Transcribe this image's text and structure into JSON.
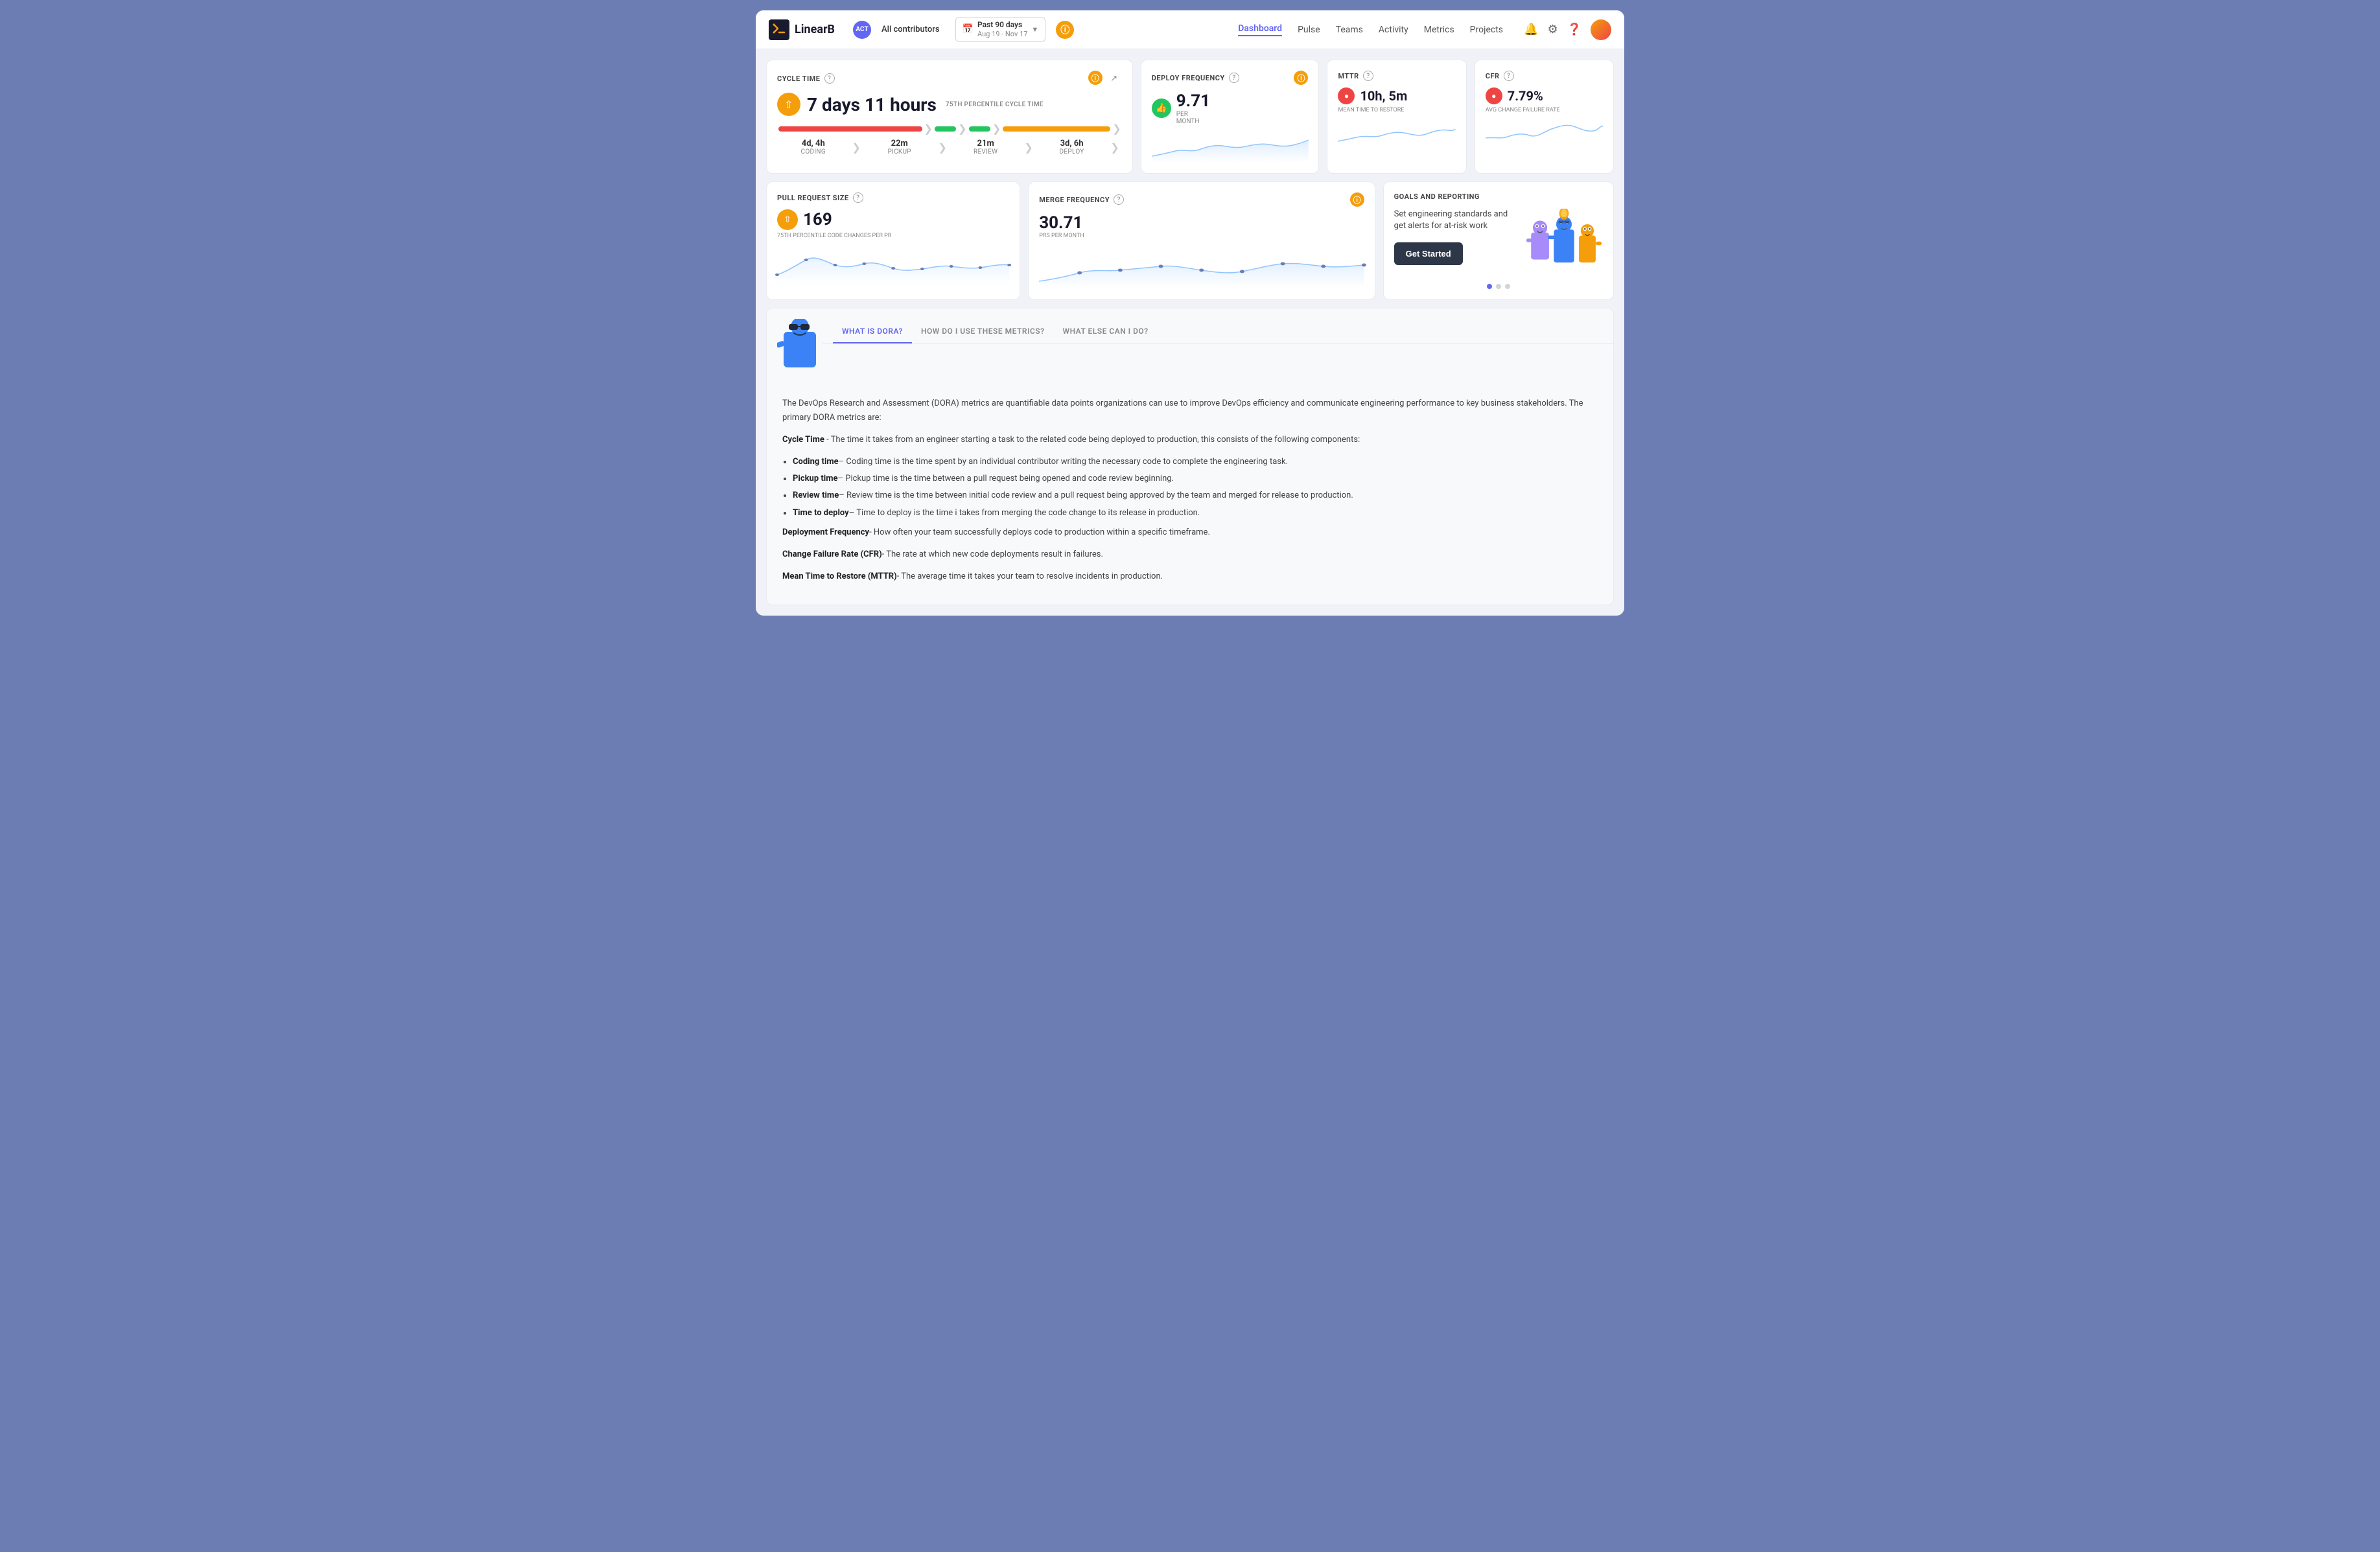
{
  "app": {
    "title": "LinearB",
    "logo_text": "LinearB"
  },
  "header": {
    "contributor_badge": "ACT",
    "contributor_label": "All contributors",
    "date_range_label": "Past 90 days",
    "date_range_sub": "Aug 19 - Nov 17",
    "nav": [
      {
        "label": "Dashboard",
        "active": true
      },
      {
        "label": "Pulse",
        "active": false
      },
      {
        "label": "Teams",
        "active": false
      },
      {
        "label": "Activity",
        "active": false
      },
      {
        "label": "Metrics",
        "active": false
      },
      {
        "label": "Projects",
        "active": false
      }
    ]
  },
  "cycle_time": {
    "title": "CYCLE TIME",
    "value": "7 days 11 hours",
    "subtitle": "75TH PERCENTILE CYCLE TIME",
    "stages": [
      {
        "value": "4d, 4h",
        "label": "CODING",
        "color": "#ef4444"
      },
      {
        "value": "22m",
        "label": "PICKUP",
        "color": "#22c55e"
      },
      {
        "value": "21m",
        "label": "REVIEW",
        "color": "#22c55e"
      },
      {
        "value": "3d, 6h",
        "label": "DEPLOY",
        "color": "#f59e0b"
      }
    ]
  },
  "deploy_frequency": {
    "title": "DEPLOY FREQUENCY",
    "value": "9.71",
    "per_label": "PER\nMONTH"
  },
  "mttr": {
    "title": "MTTR",
    "value": "10h, 5m",
    "sublabel": "MEAN TIME TO RESTORE"
  },
  "cfr": {
    "title": "CFR",
    "value": "7.79%",
    "sublabel": "AVG CHANGE FAILURE\nRATE"
  },
  "pull_request_size": {
    "title": "PULL REQUEST SIZE",
    "value": "169",
    "sublabel": "75TH PERCENTILE CODE CHANGES PER PR"
  },
  "merge_frequency": {
    "title": "MERGE FREQUENCY",
    "value": "30.71",
    "sublabel": "PRS PER MONTH"
  },
  "goals": {
    "title": "GOALS AND REPORTING",
    "description": "Set engineering standards and get alerts for at-risk work",
    "button_label": "Get Started",
    "dots": [
      {
        "active": true
      },
      {
        "active": false
      },
      {
        "active": false
      }
    ]
  },
  "info_section": {
    "tabs": [
      {
        "label": "WHAT IS DORA?",
        "active": true
      },
      {
        "label": "HOW DO I USE THESE METRICS?",
        "active": false
      },
      {
        "label": "WHAT ELSE CAN I DO?",
        "active": false
      }
    ],
    "dora_intro": "The DevOps Research and Assessment (DORA) metrics are quantifiable data points organizations can use to improve DevOps efficiency and communicate engineering performance to key business stakeholders. The primary DORA metrics are:",
    "metrics": [
      {
        "name": "Cycle Time",
        "description": "- The time it takes from an engineer starting a task to the related code being deployed to production, this consists of the following components:"
      }
    ],
    "components": [
      {
        "name": "Coding time",
        "description": "– Coding time is the time spent by an individual contributor writing the necessary code to complete the engineering task."
      },
      {
        "name": "Pickup time",
        "description": "– Pickup time is the time between a pull request being opened and code review beginning."
      },
      {
        "name": "Review time",
        "description": "– Review time is the time between initial code review and a pull request being approved by the team and merged for release to production."
      },
      {
        "name": "Time to deploy",
        "description": "– Time to deploy is the time i takes from merging the code change to its release in production."
      }
    ],
    "other_metrics": [
      {
        "name": "Deployment Frequency",
        "description": "- How often your team successfully deploys code to production within a specific timeframe."
      },
      {
        "name": "Change Failure Rate (CFR)",
        "description": "- The rate at which new code deployments result in failures."
      },
      {
        "name": "Mean Time to Restore (MTTR)",
        "description": "- The average time it takes your team to resolve incidents in production."
      }
    ]
  }
}
